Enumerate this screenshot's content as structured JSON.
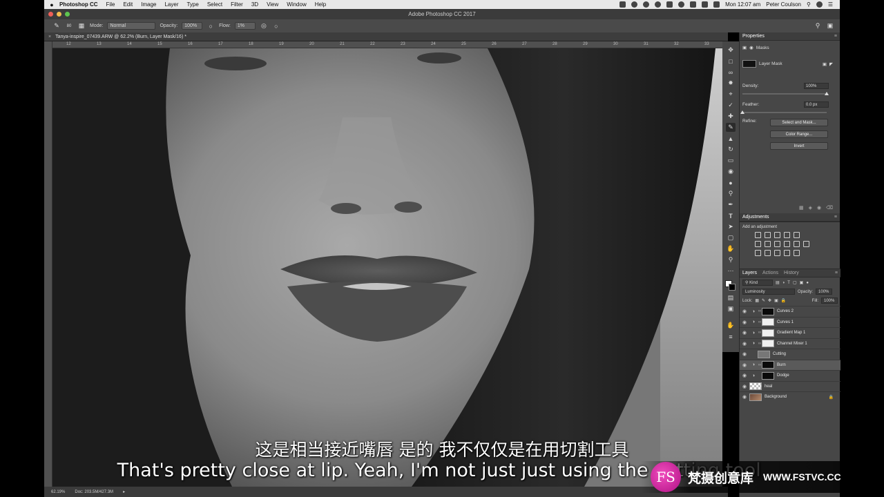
{
  "menubar": {
    "app_name": "Photoshop CC",
    "menus": [
      "File",
      "Edit",
      "Image",
      "Layer",
      "Type",
      "Select",
      "Filter",
      "3D",
      "View",
      "Window",
      "Help"
    ],
    "clock": "Mon 12:07 am",
    "user": "Peter Coulson"
  },
  "titlebar": {
    "title": "Adobe Photoshop CC 2017"
  },
  "options": {
    "brush_size": "80",
    "mode_label": "Mode:",
    "mode_value": "Normal",
    "opacity_label": "Opacity:",
    "opacity_value": "100%",
    "flow_label": "Flow:",
    "flow_value": "1%"
  },
  "document": {
    "tab_title": "Tanya-inspire_07439.ARW @ 62.2% (Burn, Layer Mask/16) *",
    "ruler_ticks": [
      "12",
      "13",
      "14",
      "15",
      "16",
      "17",
      "18",
      "19",
      "20",
      "21",
      "22",
      "23",
      "24",
      "25",
      "26",
      "27",
      "28",
      "29",
      "30",
      "31",
      "32",
      "33"
    ]
  },
  "statusbar": {
    "zoom": "62.19%",
    "doc_info": "Doc: 203.5M/427.3M"
  },
  "properties": {
    "header": "Properties",
    "masks_label": "Masks",
    "layer_mask_label": "Layer Mask",
    "density_label": "Density:",
    "density_value": "100%",
    "feather_label": "Feather:",
    "feather_value": "0.0 px",
    "refine_label": "Refine:",
    "btn_select_mask": "Select and Mask...",
    "btn_color_range": "Color Range...",
    "btn_invert": "Invert"
  },
  "adjustments": {
    "header": "Adjustments",
    "subtitle": "Add an adjustment"
  },
  "layers_panel": {
    "tabs": [
      "Layers",
      "Actions",
      "History"
    ],
    "kind_label": "Kind",
    "blend_mode": "Luminosity",
    "opacity_label": "Opacity:",
    "opacity_value": "100%",
    "lock_label": "Lock:",
    "fill_label": "Fill:",
    "fill_value": "100%",
    "layers": [
      {
        "name": "Curves 2"
      },
      {
        "name": "Curves 1"
      },
      {
        "name": "Gradient Map 1"
      },
      {
        "name": "Channel Mixer 1"
      },
      {
        "name": "Cutting"
      },
      {
        "name": "Burn"
      },
      {
        "name": "Dodge"
      },
      {
        "name": "heal"
      },
      {
        "name": "Background"
      }
    ]
  },
  "subtitles": {
    "cn": "这是相当接近嘴唇 是的 我不仅仅是在用切割工具",
    "en": "That's pretty close at lip. Yeah, I'm not just just using the cutting tool."
  },
  "watermark": {
    "logo_text": "FS",
    "cn": "梵摄创意库",
    "url": "WWW.FSTVC.CC"
  }
}
